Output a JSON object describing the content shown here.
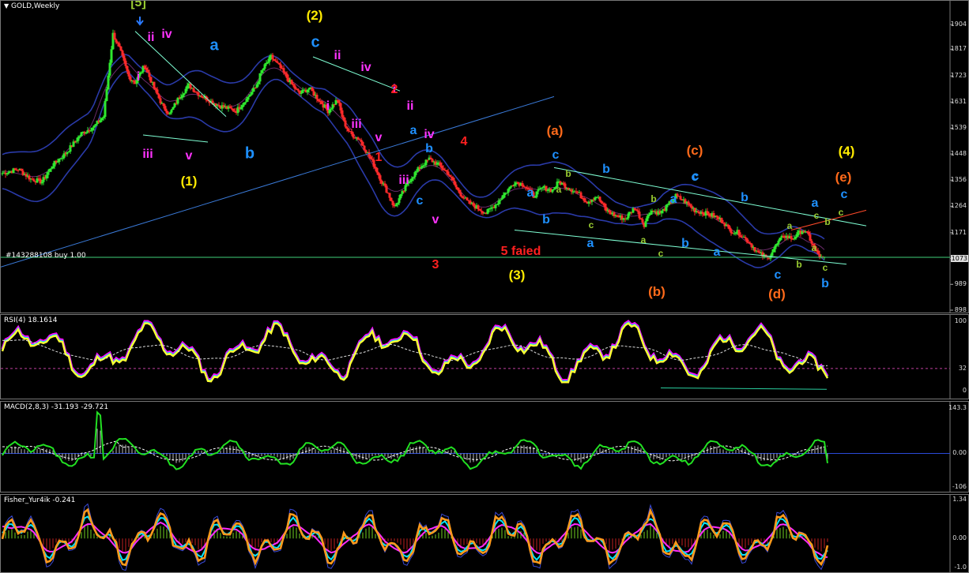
{
  "main": {
    "title": "GOLD,Weekly",
    "yticks": [
      "1904",
      "1817",
      "1723",
      "1631",
      "1539",
      "1448",
      "1356",
      "1264",
      "1171",
      "1080",
      "989",
      "898"
    ],
    "position_line": "#143288108 buy 1.00",
    "price_tag": "1073",
    "labels": [
      {
        "t": "[5]",
        "c": "#9acd32",
        "s": 16
      },
      {
        "t": "(2)",
        "c": "#ffeb00",
        "s": 17
      },
      {
        "t": "c",
        "c": "#1e90ff",
        "s": 20
      },
      {
        "t": "a",
        "c": "#1e90ff",
        "s": 20
      },
      {
        "t": "b",
        "c": "#1e90ff",
        "s": 20
      },
      {
        "t": "(1)",
        "c": "#ffeb00",
        "s": 17
      },
      {
        "t": "ii",
        "c": "#ff33ff",
        "s": 16
      },
      {
        "t": "iv",
        "c": "#ff33ff",
        "s": 16
      },
      {
        "t": "i",
        "c": "#ff33ff",
        "s": 16
      },
      {
        "t": "iii",
        "c": "#ff33ff",
        "s": 16
      },
      {
        "t": "v",
        "c": "#ff33ff",
        "s": 16
      },
      {
        "t": "ii",
        "c": "#ff33ff",
        "s": 16
      },
      {
        "t": "iv",
        "c": "#ff33ff",
        "s": 16
      },
      {
        "t": "i",
        "c": "#ff33ff",
        "s": 16
      },
      {
        "t": "iii",
        "c": "#ff33ff",
        "s": 16
      },
      {
        "t": "v",
        "c": "#ff33ff",
        "s": 16
      },
      {
        "t": "i",
        "c": "#ff33ff",
        "s": 16
      },
      {
        "t": "ii",
        "c": "#ff33ff",
        "s": 16
      },
      {
        "t": "iii",
        "c": "#ff33ff",
        "s": 16
      },
      {
        "t": "iv",
        "c": "#ff33ff",
        "s": 16
      },
      {
        "t": "v",
        "c": "#ff33ff",
        "s": 16
      },
      {
        "t": "2",
        "c": "#ff2020",
        "s": 16
      },
      {
        "t": "1",
        "c": "#ff2020",
        "s": 16
      },
      {
        "t": "4",
        "c": "#ff2020",
        "s": 16
      },
      {
        "t": "3",
        "c": "#ff2020",
        "s": 16
      },
      {
        "t": "a",
        "c": "#1e90ff",
        "s": 16
      },
      {
        "t": "c",
        "c": "#1e90ff",
        "s": 16
      },
      {
        "t": "b",
        "c": "#1e90ff",
        "s": 16
      },
      {
        "t": "5 faied",
        "c": "#ff2020",
        "s": 16
      },
      {
        "t": "(3)",
        "c": "#ffeb00",
        "s": 17
      },
      {
        "t": "(a)",
        "c": "#ff6a1a",
        "s": 17
      },
      {
        "t": "c",
        "c": "#1e90ff",
        "s": 16
      },
      {
        "t": "a",
        "c": "#1e90ff",
        "s": 16
      },
      {
        "t": "b",
        "c": "#1e90ff",
        "s": 16
      },
      {
        "t": "b",
        "c": "#9acd32",
        "s": 12
      },
      {
        "t": "a",
        "c": "#9acd32",
        "s": 12
      },
      {
        "t": "c",
        "c": "#9acd32",
        "s": 12
      },
      {
        "t": "b",
        "c": "#1e90ff",
        "s": 16
      },
      {
        "t": "a",
        "c": "#1e90ff",
        "s": 16
      },
      {
        "t": "c",
        "c": "#1e90ff",
        "s": 16
      },
      {
        "t": "(b)",
        "c": "#ff6a1a",
        "s": 17
      },
      {
        "t": "b",
        "c": "#9acd32",
        "s": 12
      },
      {
        "t": "a",
        "c": "#9acd32",
        "s": 12
      },
      {
        "t": "c",
        "c": "#9acd32",
        "s": 12
      },
      {
        "t": "a",
        "c": "#1e90ff",
        "s": 16
      },
      {
        "t": "b",
        "c": "#1e90ff",
        "s": 16
      },
      {
        "t": "(c)",
        "c": "#ff6a1a",
        "s": 17
      },
      {
        "t": "c",
        "c": "#1e90ff",
        "s": 16
      },
      {
        "t": "a",
        "c": "#1e90ff",
        "s": 16
      },
      {
        "t": "b",
        "c": "#1e90ff",
        "s": 16
      },
      {
        "t": "c",
        "c": "#1e90ff",
        "s": 16
      },
      {
        "t": "(d)",
        "c": "#ff6a1a",
        "s": 17
      },
      {
        "t": "a",
        "c": "#9acd32",
        "s": 12
      },
      {
        "t": "b",
        "c": "#9acd32",
        "s": 12
      },
      {
        "t": "a",
        "c": "#9acd32",
        "s": 12
      },
      {
        "t": "c",
        "c": "#9acd32",
        "s": 12
      },
      {
        "t": "b",
        "c": "#9acd32",
        "s": 12
      },
      {
        "t": "c",
        "c": "#9acd32",
        "s": 12
      },
      {
        "t": "(4)",
        "c": "#ffeb00",
        "s": 17
      },
      {
        "t": "(e)",
        "c": "#ff6a1a",
        "s": 17
      },
      {
        "t": "c",
        "c": "#1e90ff",
        "s": 16
      },
      {
        "t": "a",
        "c": "#1e90ff",
        "s": 16
      },
      {
        "t": "c",
        "c": "#9acd32",
        "s": 12
      },
      {
        "t": "b",
        "c": "#1e90ff",
        "s": 16
      }
    ]
  },
  "rsi": {
    "title": "RSI(4) 18.1614",
    "yticks": [
      "100",
      "32",
      "0"
    ]
  },
  "macd": {
    "title": "MACD(2,8,3) -31.193 -29.721",
    "yticks": [
      "143.3",
      "0.00",
      "-106"
    ]
  },
  "fisher": {
    "title": "Fisher_Yur4ik -0.241",
    "yticks": [
      "1.34",
      "0.00",
      "-1.0"
    ]
  },
  "colors": {
    "bull": "#2ee82e",
    "bear": "#ff2a2a",
    "band": "#2a3aa8",
    "trend": "#7fffd4",
    "rsi_main": "#ffff33",
    "rsi_mag": "#ff00ff",
    "rsi_cyan": "#00e5ff",
    "macd": "#22e022",
    "fisher_or": "#ff9a1a",
    "fisher_cy": "#00e5ff",
    "fisher_mg": "#ff2aff"
  },
  "chart_data": [
    {
      "type": "candlestick",
      "title": "GOLD,Weekly",
      "ylim": [
        898,
        1904
      ],
      "close_path": [
        [
          0,
          1380
        ],
        [
          10,
          1395
        ],
        [
          18,
          1360
        ],
        [
          25,
          1350
        ],
        [
          32,
          1410
        ],
        [
          40,
          1450
        ],
        [
          50,
          1520
        ],
        [
          58,
          1545
        ],
        [
          64,
          1580
        ],
        [
          70,
          1870
        ],
        [
          74,
          1820
        ],
        [
          80,
          1720
        ],
        [
          84,
          1700
        ],
        [
          90,
          1760
        ],
        [
          96,
          1680
        ],
        [
          102,
          1610
        ],
        [
          106,
          1590
        ],
        [
          112,
          1650
        ],
        [
          118,
          1690
        ],
        [
          124,
          1660
        ],
        [
          130,
          1640
        ],
        [
          136,
          1620
        ],
        [
          142,
          1610
        ],
        [
          148,
          1600
        ],
        [
          154,
          1640
        ],
        [
          160,
          1680
        ],
        [
          164,
          1740
        ],
        [
          170,
          1790
        ],
        [
          176,
          1750
        ],
        [
          182,
          1700
        ],
        [
          188,
          1660
        ],
        [
          194,
          1680
        ],
        [
          200,
          1640
        ],
        [
          206,
          1600
        ],
        [
          212,
          1640
        ],
        [
          216,
          1560
        ],
        [
          220,
          1520
        ],
        [
          226,
          1500
        ],
        [
          232,
          1440
        ],
        [
          236,
          1400
        ],
        [
          240,
          1350
        ],
        [
          244,
          1310
        ],
        [
          248,
          1260
        ],
        [
          252,
          1300
        ],
        [
          258,
          1360
        ],
        [
          264,
          1400
        ],
        [
          270,
          1430
        ],
        [
          276,
          1410
        ],
        [
          282,
          1380
        ],
        [
          288,
          1320
        ],
        [
          294,
          1280
        ],
        [
          300,
          1260
        ],
        [
          306,
          1240
        ],
        [
          312,
          1270
        ],
        [
          318,
          1310
        ],
        [
          324,
          1350
        ],
        [
          330,
          1340
        ],
        [
          336,
          1300
        ],
        [
          342,
          1330
        ],
        [
          348,
          1320
        ],
        [
          352,
          1350
        ],
        [
          358,
          1330
        ],
        [
          364,
          1310
        ],
        [
          370,
          1280
        ],
        [
          376,
          1300
        ],
        [
          382,
          1250
        ],
        [
          388,
          1230
        ],
        [
          394,
          1220
        ],
        [
          400,
          1260
        ],
        [
          406,
          1200
        ],
        [
          410,
          1250
        ],
        [
          416,
          1240
        ],
        [
          420,
          1260
        ],
        [
          426,
          1300
        ],
        [
          432,
          1280
        ],
        [
          438,
          1250
        ],
        [
          444,
          1240
        ],
        [
          450,
          1230
        ],
        [
          456,
          1210
        ],
        [
          460,
          1180
        ],
        [
          466,
          1170
        ],
        [
          472,
          1140
        ],
        [
          478,
          1100
        ],
        [
          484,
          1080
        ],
        [
          490,
          1130
        ],
        [
          494,
          1160
        ],
        [
          500,
          1150
        ],
        [
          506,
          1180
        ],
        [
          510,
          1160
        ],
        [
          514,
          1110
        ],
        [
          518,
          1080
        ]
      ]
    },
    {
      "type": "line",
      "title": "RSI(4) 18.1614",
      "ylim": [
        0,
        100
      ],
      "levels": [
        32
      ],
      "last": 18.16
    },
    {
      "type": "line",
      "title": "MACD(2,8,3) -31.193 -29.721",
      "ylim": [
        -106,
        143.3
      ],
      "last": [
        -31.193,
        -29.721
      ]
    },
    {
      "type": "line",
      "title": "Fisher_Yur4ik -0.241",
      "ylim": [
        -1.0,
        1.34
      ],
      "last": -0.241
    }
  ]
}
